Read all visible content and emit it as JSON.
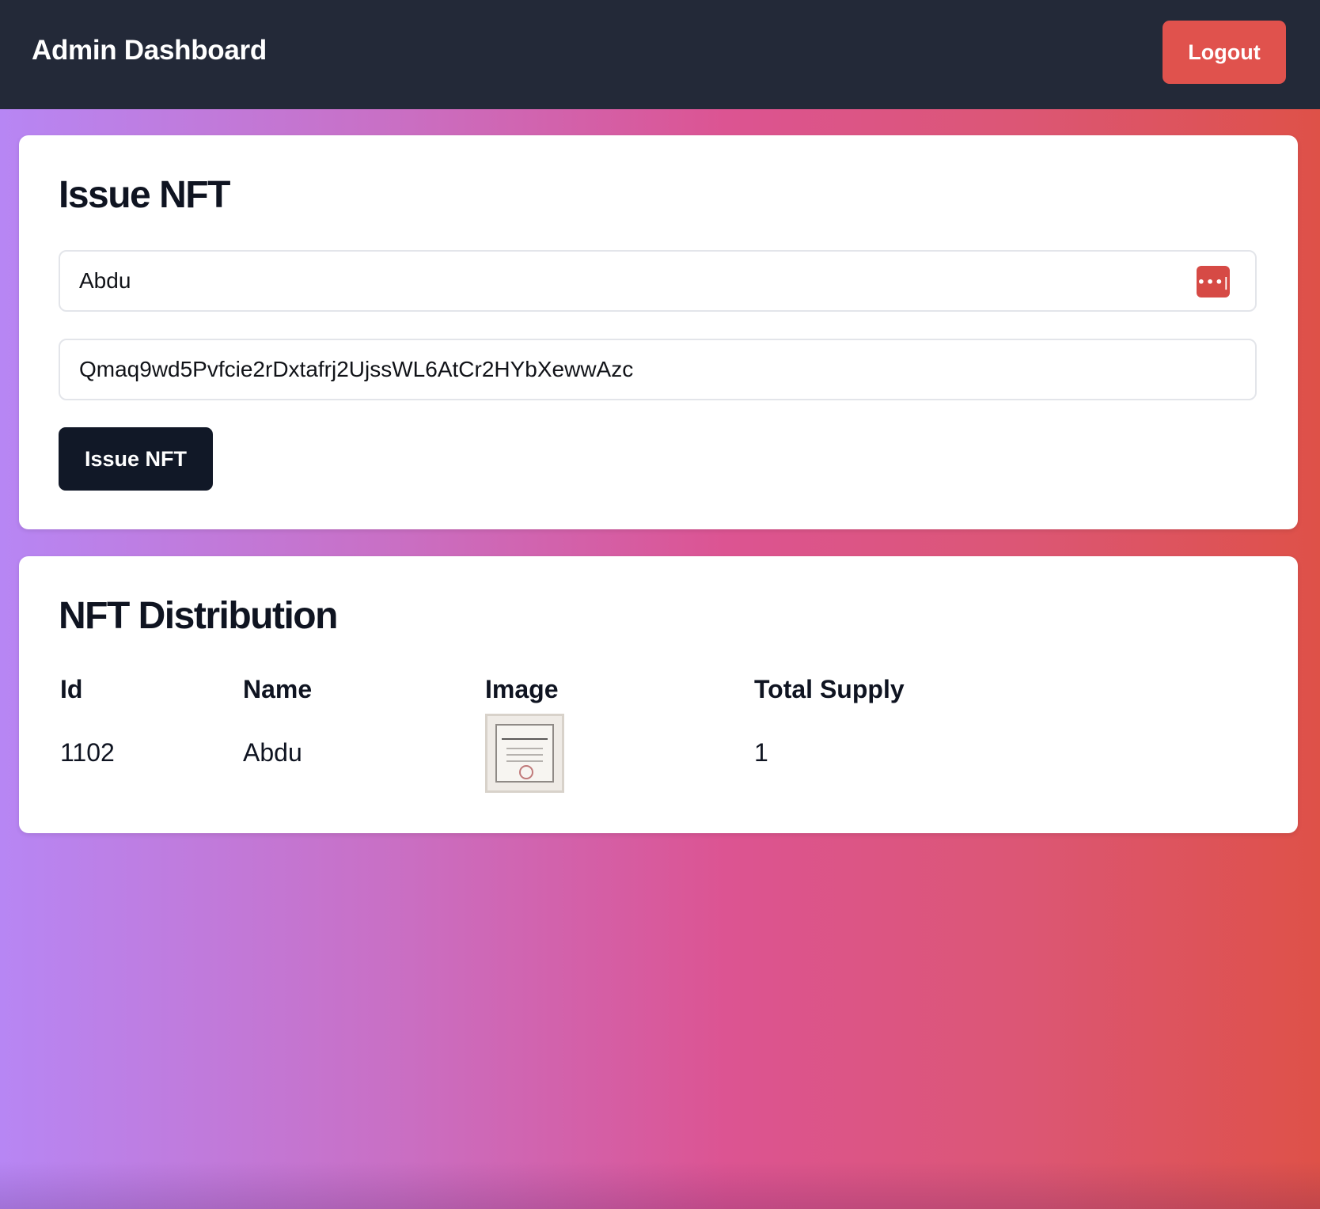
{
  "header": {
    "title": "Admin Dashboard",
    "logout_label": "Logout"
  },
  "issue": {
    "title": "Issue NFT",
    "name_value": "Abdu",
    "hash_value": "Qmaq9wd5Pvfcie2rDxtafrj2UjssWL6AtCr2HYbXewwAzc",
    "password_manager_icon": "password-manager-icon",
    "button_label": "Issue NFT"
  },
  "distribution": {
    "title": "NFT Distribution",
    "columns": [
      "Id",
      "Name",
      "Image",
      "Total Supply"
    ],
    "rows": [
      {
        "id": "1102",
        "name": "Abdu",
        "image_desc": "graduation-certificate-thumbnail",
        "total_supply": "1"
      }
    ]
  },
  "colors": {
    "topbar": "#232938",
    "logout": "#e0524d",
    "primary_button": "#111827",
    "gradient": [
      "#b786f4",
      "#dc5492",
      "#de5148"
    ]
  }
}
